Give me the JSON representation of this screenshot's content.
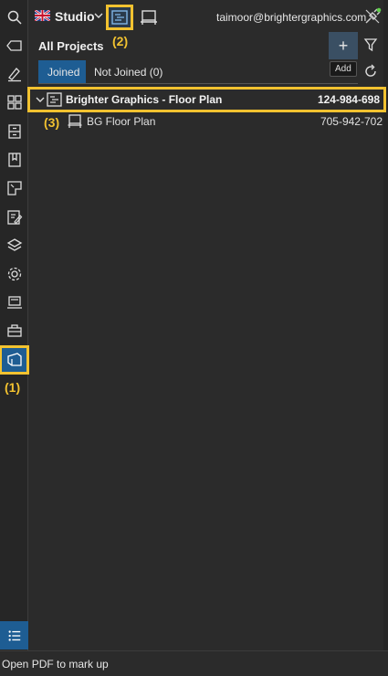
{
  "header": {
    "workspace": "Studio",
    "email": "taimoor@brightergraphics.com"
  },
  "panel": {
    "title": "All Projects",
    "add_label": "+",
    "add_tooltip": "Add",
    "tabs": [
      "Joined",
      "Not Joined (0)"
    ]
  },
  "projects": [
    {
      "name": "Brighter Graphics - Floor Plan",
      "id": "124-984-698",
      "documents": [
        {
          "name": "BG Floor Plan",
          "id": "705-942-702"
        }
      ]
    }
  ],
  "callouts": {
    "one": "(1)",
    "two": "(2)",
    "three": "(3)"
  },
  "status": {
    "message": "Open PDF to mark up"
  },
  "colors": {
    "accent": "#1e5d93",
    "highlight": "#f2c230",
    "background": "#2b2b2b"
  }
}
